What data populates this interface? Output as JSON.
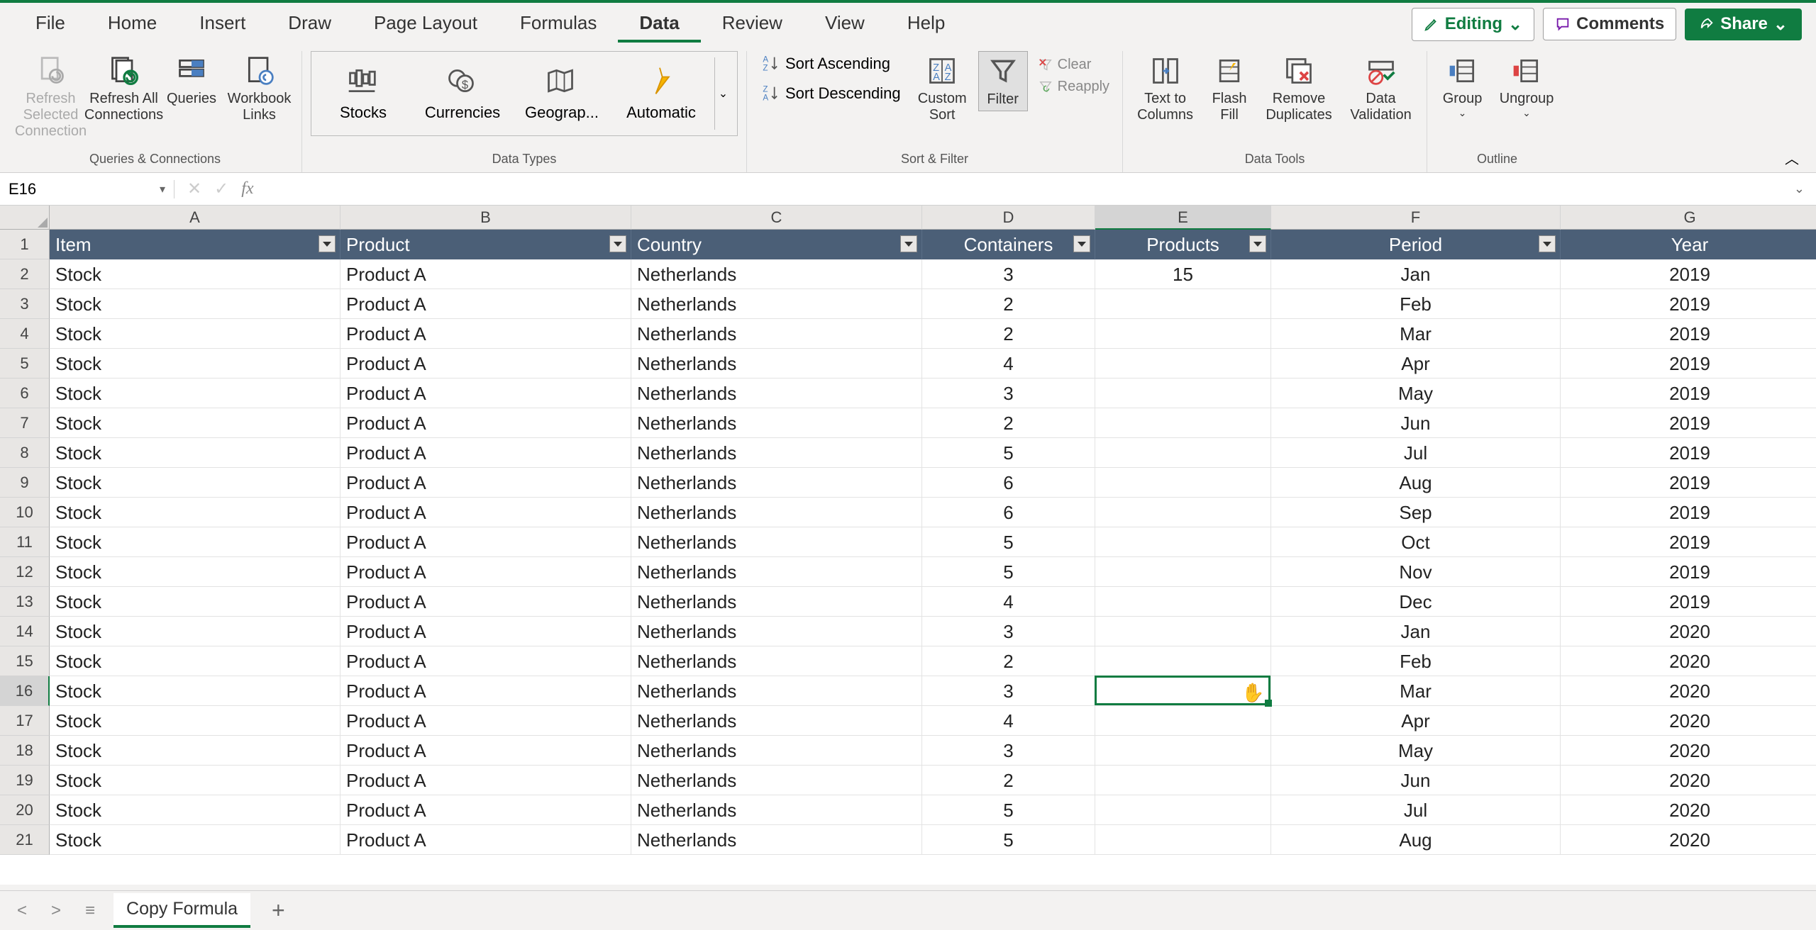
{
  "tabs": [
    "File",
    "Home",
    "Insert",
    "Draw",
    "Page Layout",
    "Formulas",
    "Data",
    "Review",
    "View",
    "Help"
  ],
  "active_tab": "Data",
  "editing_btn": "Editing",
  "comments_btn": "Comments",
  "share_btn": "Share",
  "ribbon": {
    "queries": {
      "refresh_selected": "Refresh Selected Connection",
      "refresh_all": "Refresh All Connections",
      "queries_conn": "Queries and Connections",
      "workbook_links": "Workbook Links",
      "label": "Queries & Connections"
    },
    "data_types": {
      "stocks": "Stocks",
      "currencies": "Currencies",
      "geography": "Geograp...",
      "automatic": "Automatic",
      "label": "Data Types"
    },
    "sort_filter": {
      "asc": "Sort Ascending",
      "desc": "Sort Descending",
      "custom": "Custom Sort",
      "filter": "Filter",
      "clear": "Clear",
      "reapply": "Reapply",
      "label": "Sort & Filter"
    },
    "data_tools": {
      "text_cols": "Text to Columns",
      "flash_fill": "Flash Fill",
      "remove_dup": "Remove Duplicates",
      "validation": "Data Validation",
      "label": "Data Tools"
    },
    "outline": {
      "group": "Group",
      "ungroup": "Ungroup",
      "label": "Outline"
    }
  },
  "name_box": "E16",
  "formula": "",
  "columns": [
    "A",
    "B",
    "C",
    "D",
    "E",
    "F",
    "G"
  ],
  "selected_col": "E",
  "selected_row": 16,
  "headers": [
    "Item",
    "Product",
    "Country",
    "Containers",
    "Products",
    "Period",
    "Year"
  ],
  "filterable": [
    true,
    true,
    true,
    true,
    true,
    true,
    false
  ],
  "header_align": [
    "left",
    "left",
    "left",
    "center",
    "center",
    "center",
    "center"
  ],
  "rows": [
    {
      "r": 2,
      "item": "Stock",
      "product": "Product A",
      "country": "Netherlands",
      "containers": "3",
      "products": "15",
      "period": "Jan",
      "year": "2019"
    },
    {
      "r": 3,
      "item": "Stock",
      "product": "Product A",
      "country": "Netherlands",
      "containers": "2",
      "products": "",
      "period": "Feb",
      "year": "2019"
    },
    {
      "r": 4,
      "item": "Stock",
      "product": "Product A",
      "country": "Netherlands",
      "containers": "2",
      "products": "",
      "period": "Mar",
      "year": "2019"
    },
    {
      "r": 5,
      "item": "Stock",
      "product": "Product A",
      "country": "Netherlands",
      "containers": "4",
      "products": "",
      "period": "Apr",
      "year": "2019"
    },
    {
      "r": 6,
      "item": "Stock",
      "product": "Product A",
      "country": "Netherlands",
      "containers": "3",
      "products": "",
      "period": "May",
      "year": "2019"
    },
    {
      "r": 7,
      "item": "Stock",
      "product": "Product A",
      "country": "Netherlands",
      "containers": "2",
      "products": "",
      "period": "Jun",
      "year": "2019"
    },
    {
      "r": 8,
      "item": "Stock",
      "product": "Product A",
      "country": "Netherlands",
      "containers": "5",
      "products": "",
      "period": "Jul",
      "year": "2019"
    },
    {
      "r": 9,
      "item": "Stock",
      "product": "Product A",
      "country": "Netherlands",
      "containers": "6",
      "products": "",
      "period": "Aug",
      "year": "2019"
    },
    {
      "r": 10,
      "item": "Stock",
      "product": "Product A",
      "country": "Netherlands",
      "containers": "6",
      "products": "",
      "period": "Sep",
      "year": "2019"
    },
    {
      "r": 11,
      "item": "Stock",
      "product": "Product A",
      "country": "Netherlands",
      "containers": "5",
      "products": "",
      "period": "Oct",
      "year": "2019"
    },
    {
      "r": 12,
      "item": "Stock",
      "product": "Product A",
      "country": "Netherlands",
      "containers": "5",
      "products": "",
      "period": "Nov",
      "year": "2019"
    },
    {
      "r": 13,
      "item": "Stock",
      "product": "Product A",
      "country": "Netherlands",
      "containers": "4",
      "products": "",
      "period": "Dec",
      "year": "2019"
    },
    {
      "r": 14,
      "item": "Stock",
      "product": "Product A",
      "country": "Netherlands",
      "containers": "3",
      "products": "",
      "period": "Jan",
      "year": "2020"
    },
    {
      "r": 15,
      "item": "Stock",
      "product": "Product A",
      "country": "Netherlands",
      "containers": "2",
      "products": "",
      "period": "Feb",
      "year": "2020"
    },
    {
      "r": 16,
      "item": "Stock",
      "product": "Product A",
      "country": "Netherlands",
      "containers": "3",
      "products": "",
      "period": "Mar",
      "year": "2020"
    },
    {
      "r": 17,
      "item": "Stock",
      "product": "Product A",
      "country": "Netherlands",
      "containers": "4",
      "products": "",
      "period": "Apr",
      "year": "2020"
    },
    {
      "r": 18,
      "item": "Stock",
      "product": "Product A",
      "country": "Netherlands",
      "containers": "3",
      "products": "",
      "period": "May",
      "year": "2020"
    },
    {
      "r": 19,
      "item": "Stock",
      "product": "Product A",
      "country": "Netherlands",
      "containers": "2",
      "products": "",
      "period": "Jun",
      "year": "2020"
    },
    {
      "r": 20,
      "item": "Stock",
      "product": "Product A",
      "country": "Netherlands",
      "containers": "5",
      "products": "",
      "period": "Jul",
      "year": "2020"
    },
    {
      "r": 21,
      "item": "Stock",
      "product": "Product A",
      "country": "Netherlands",
      "containers": "5",
      "products": "",
      "period": "Aug",
      "year": "2020"
    }
  ],
  "sheet_tabs": [
    "Copy Formula"
  ],
  "active_sheet": "Copy Formula"
}
